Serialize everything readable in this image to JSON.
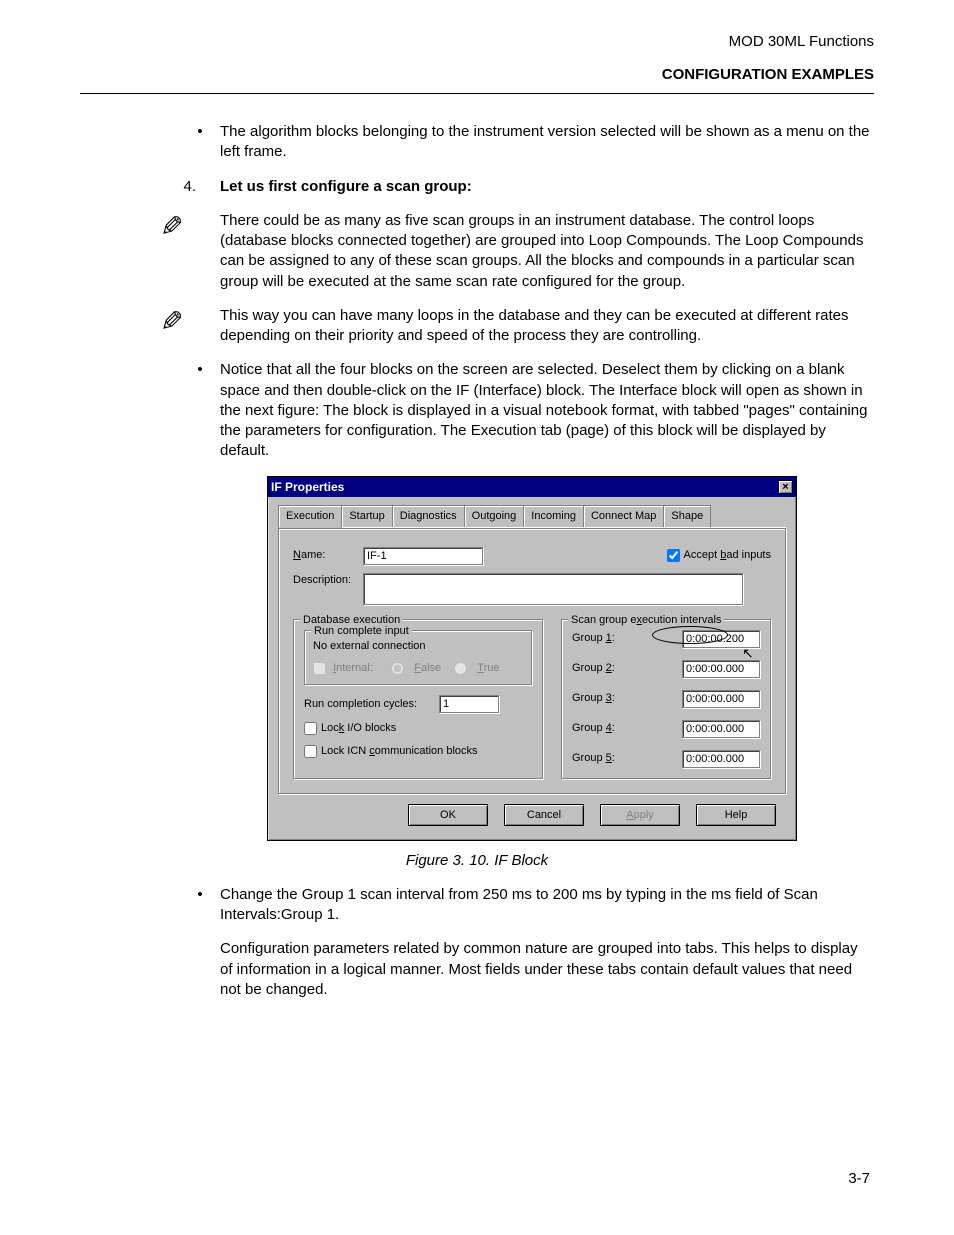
{
  "header": {
    "product": "MOD 30ML Functions",
    "section": "CONFIGURATION EXAMPLES"
  },
  "paragraphs": {
    "p1": "The algorithm blocks belonging to the instrument version selected will be shown as a menu on the left frame.",
    "step4_num": "4.",
    "step4_text": "Let us first configure a scan group:",
    "note1": "There could be as many as five scan groups in an instrument database. The control loops (database blocks connected together) are grouped into Loop Compounds. The Loop Compounds can be assigned to any of these scan groups. All the blocks and compounds in a particular scan group will be executed at the same scan rate configured for the group.",
    "note2": "This way you can have many loops in the database and they can be executed at different rates depending on their priority and speed of the process they are controlling.",
    "p2": "Notice that all the four blocks on the screen are selected. Deselect them by clicking on a blank space and then double-click on the IF (Interface) block. The Interface block will open as shown in the next figure: The block is displayed in a visual notebook format, with tabbed \"pages\" containing the parameters for configuration. The Execution tab (page) of this block will be displayed by default.",
    "p3": "Change the Group 1 scan interval from 250 ms to 200 ms by typing in the ms field of Scan Intervals:Group 1.",
    "p4": "Configuration parameters related by common nature are grouped into tabs. This helps to display of information in a logical manner. Most fields under these tabs contain default values that need not be changed."
  },
  "figure_caption": "Figure 3. 10. IF Block",
  "dialog": {
    "title": "IF Properties",
    "close": "×",
    "tabs": [
      "Execution",
      "Startup",
      "Diagnostics",
      "Outgoing",
      "Incoming",
      "Connect Map",
      "Shape"
    ],
    "name_label": "Name:",
    "name_value": "IF-1",
    "desc_label": "Description:",
    "accept_bad": "Accept bad inputs",
    "db_exec": "Database execution",
    "run_complete": "Run complete input",
    "no_ext": "No external connection",
    "internal": "Internal:",
    "false": "False",
    "true": "True",
    "run_cycles": "Run completion cycles:",
    "run_cycles_val": "1",
    "lock_io": "Lock I/O blocks",
    "lock_icn": "Lock ICN communication blocks",
    "scan_group_title": "Scan group execution intervals",
    "groups": [
      {
        "label": "Group 1:",
        "value": "0:00:00.200"
      },
      {
        "label": "Group 2:",
        "value": "0:00:00.000"
      },
      {
        "label": "Group 3:",
        "value": "0:00:00.000"
      },
      {
        "label": "Group 4:",
        "value": "0:00:00.000"
      },
      {
        "label": "Group 5:",
        "value": "0:00:00.000"
      }
    ],
    "buttons": {
      "ok": "OK",
      "cancel": "Cancel",
      "apply": "Apply",
      "help": "Help"
    }
  },
  "page_number": "3-7"
}
